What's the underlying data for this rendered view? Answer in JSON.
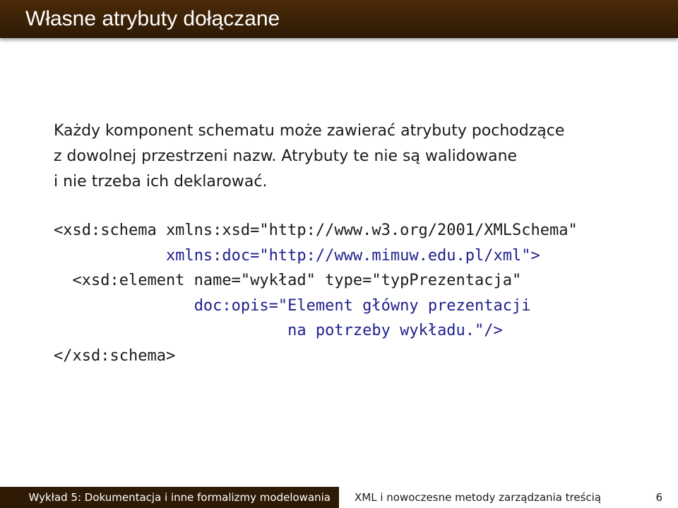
{
  "slide": {
    "title": "Własne atrybuty dołączane",
    "intro_lines": [
      "Każdy komponent schematu może zawierać atrybuty pochodzące",
      "z dowolnej przestrzeni nazw. Atrybuty te nie są walidowane",
      "i nie trzeba ich deklarować."
    ],
    "code": {
      "l1": "<xsd:schema xmlns:xsd=\"http://www.w3.org/2001/XMLSchema\"",
      "l2_indent": "            ",
      "l2": "xmlns:doc=\"http://www.mimuw.edu.pl/xml\">",
      "l3": "  <xsd:element name=\"wykład\" type=\"typPrezentacja\"",
      "l4_indent": "               ",
      "l4": "doc:opis=\"Element główny prezentacji",
      "l5_indent": "                         ",
      "l5": "na potrzeby wykładu.\"/>",
      "l6": "</xsd:schema>"
    }
  },
  "footer": {
    "lecture": "Wykład 5: Dokumentacja i inne formalizmy modelowania",
    "course": "XML i nowoczesne metody zarządzania treścią",
    "page_number": "6"
  },
  "colors": {
    "header_brown": "#2e1a05",
    "highlight_code": "#1f1f8c"
  }
}
